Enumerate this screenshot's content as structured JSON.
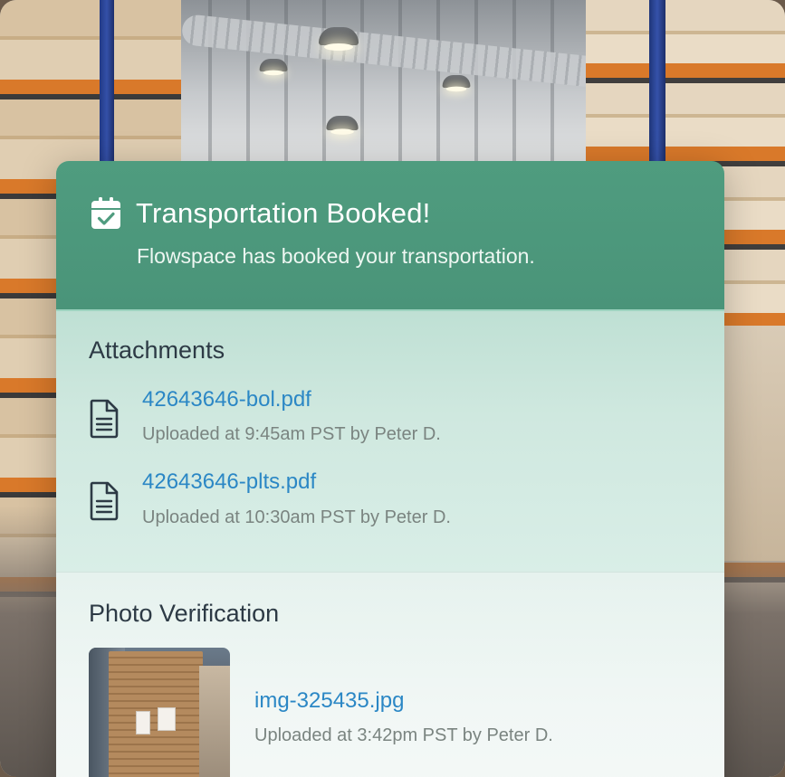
{
  "header": {
    "title": "Transportation Booked!",
    "subtitle": "Flowspace has booked your transportation.",
    "icon": "calendar-check-icon"
  },
  "attachments": {
    "title": "Attachments",
    "items": [
      {
        "filename": "42643646-bol.pdf",
        "meta": "Uploaded at 9:45am PST by Peter D.",
        "icon": "document-icon"
      },
      {
        "filename": "42643646-plts.pdf",
        "meta": "Uploaded at 10:30am PST by Peter D.",
        "icon": "document-icon"
      }
    ]
  },
  "photo_verification": {
    "title": "Photo Verification",
    "photo": {
      "filename": "img-325435.jpg",
      "meta": "Uploaded at 3:42pm PST by Peter D."
    }
  },
  "colors": {
    "header_bg": "#4f9c7f",
    "link": "#2b87c5",
    "title_text": "#2d3a45",
    "meta_text": "#7a8480"
  }
}
